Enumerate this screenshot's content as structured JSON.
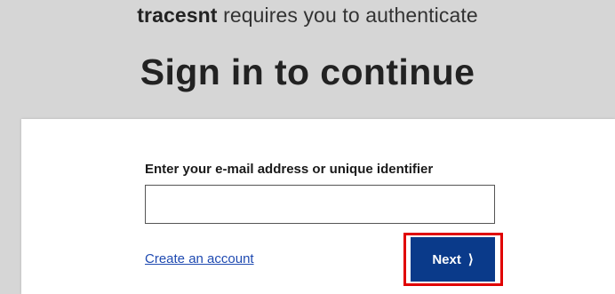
{
  "header": {
    "app_name": "tracesnt",
    "requires_text": " requires you to authenticate",
    "title": "Sign in to continue"
  },
  "form": {
    "email_label": "Enter your e-mail address or unique identifier",
    "email_value": "",
    "email_placeholder": "",
    "create_account_label": "Create an account",
    "next_label": "Next",
    "next_icon": "chevron-right-icon"
  },
  "colors": {
    "background": "#d6d6d6",
    "card": "#ffffff",
    "next_button": "#0a3a8a",
    "link": "#1f4ab1",
    "highlight": "#e00000"
  }
}
